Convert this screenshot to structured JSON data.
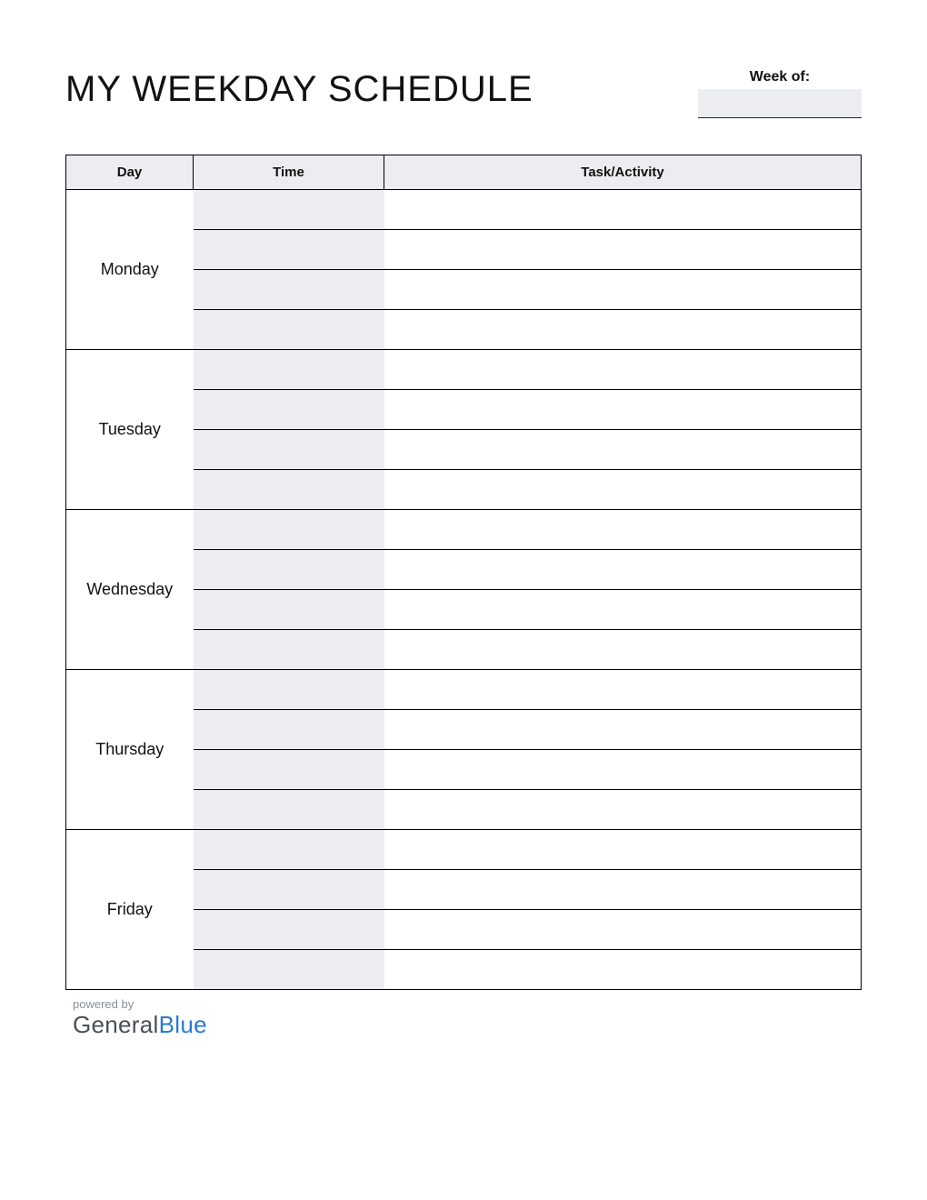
{
  "title": "MY WEEKDAY SCHEDULE",
  "week_of_label": "Week of:",
  "week_of_value": "",
  "columns": {
    "day": "Day",
    "time": "Time",
    "task": "Task/Activity"
  },
  "days": [
    "Monday",
    "Tuesday",
    "Wednesday",
    "Thursday",
    "Friday"
  ],
  "rows_per_day": 4,
  "footer": {
    "powered": "powered by",
    "brand_first": "General",
    "brand_second": "Blue"
  }
}
